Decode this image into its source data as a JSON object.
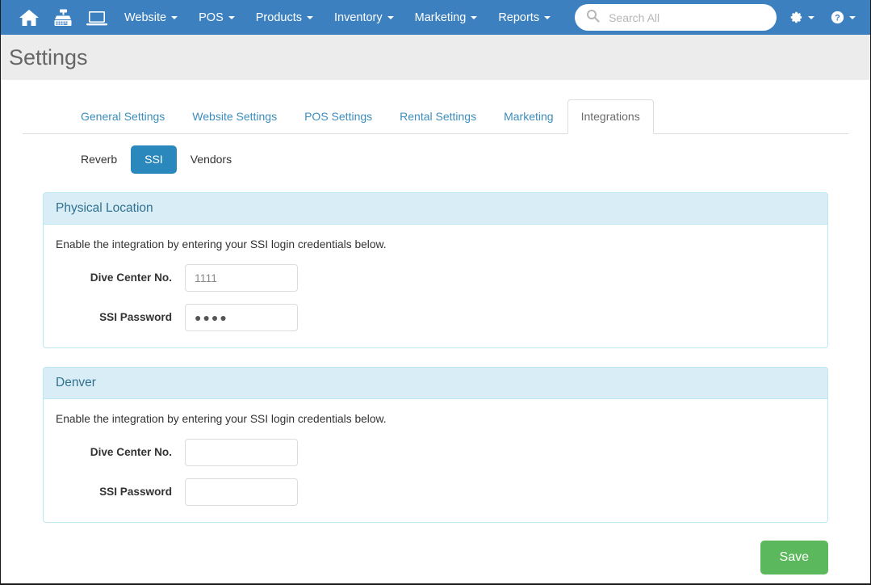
{
  "navbar": {
    "icons": [
      {
        "name": "home-icon",
        "label": "Home"
      },
      {
        "name": "cash-register-icon",
        "label": "POS Register"
      },
      {
        "name": "laptop-icon",
        "label": "Website"
      }
    ],
    "menus": [
      {
        "label": "Website"
      },
      {
        "label": "POS"
      },
      {
        "label": "Products"
      },
      {
        "label": "Inventory"
      },
      {
        "label": "Marketing"
      },
      {
        "label": "Reports"
      }
    ],
    "search": {
      "placeholder": "Search All",
      "value": "",
      "icon": "search-icon"
    },
    "right_icons": [
      {
        "name": "gear-icon",
        "label": "Settings"
      },
      {
        "name": "help-circle-icon",
        "label": "Help"
      }
    ],
    "background_color": "#3c80bf"
  },
  "header": {
    "title": "Settings"
  },
  "tabs": [
    {
      "label": "General Settings",
      "active": false
    },
    {
      "label": "Website Settings",
      "active": false
    },
    {
      "label": "POS Settings",
      "active": false
    },
    {
      "label": "Rental Settings",
      "active": false
    },
    {
      "label": "Marketing",
      "active": false
    },
    {
      "label": "Integrations",
      "active": true
    }
  ],
  "subtabs": [
    {
      "label": "Reverb",
      "active": false
    },
    {
      "label": "SSI",
      "active": true
    },
    {
      "label": "Vendors",
      "active": false
    }
  ],
  "panels": [
    {
      "title": "Physical Location",
      "description": "Enable the integration by entering your SSI login credentials below.",
      "fields": [
        {
          "label": "Dive Center No.",
          "value": "1111",
          "placeholder": "",
          "type": "text"
        },
        {
          "label": "SSI Password",
          "value": "●●●●",
          "placeholder": "",
          "type": "password"
        }
      ]
    },
    {
      "title": "Denver",
      "description": "Enable the integration by entering your SSI login credentials below.",
      "fields": [
        {
          "label": "Dive Center No.",
          "value": "",
          "placeholder": "",
          "type": "text"
        },
        {
          "label": "SSI Password",
          "value": "",
          "placeholder": "",
          "type": "password"
        }
      ]
    }
  ],
  "footer": {
    "save_label": "Save",
    "save_color": "#5cb85c"
  },
  "colors": {
    "navbar": "#3c80bf",
    "title_bar": "#ececec",
    "panel_header": "#d9edf7",
    "panel_border": "#bce8f1",
    "panel_title_text": "#31708f",
    "tab_link": "#3c8dbc",
    "pill_active": "#2a88bd",
    "save_green": "#5cb85c"
  }
}
